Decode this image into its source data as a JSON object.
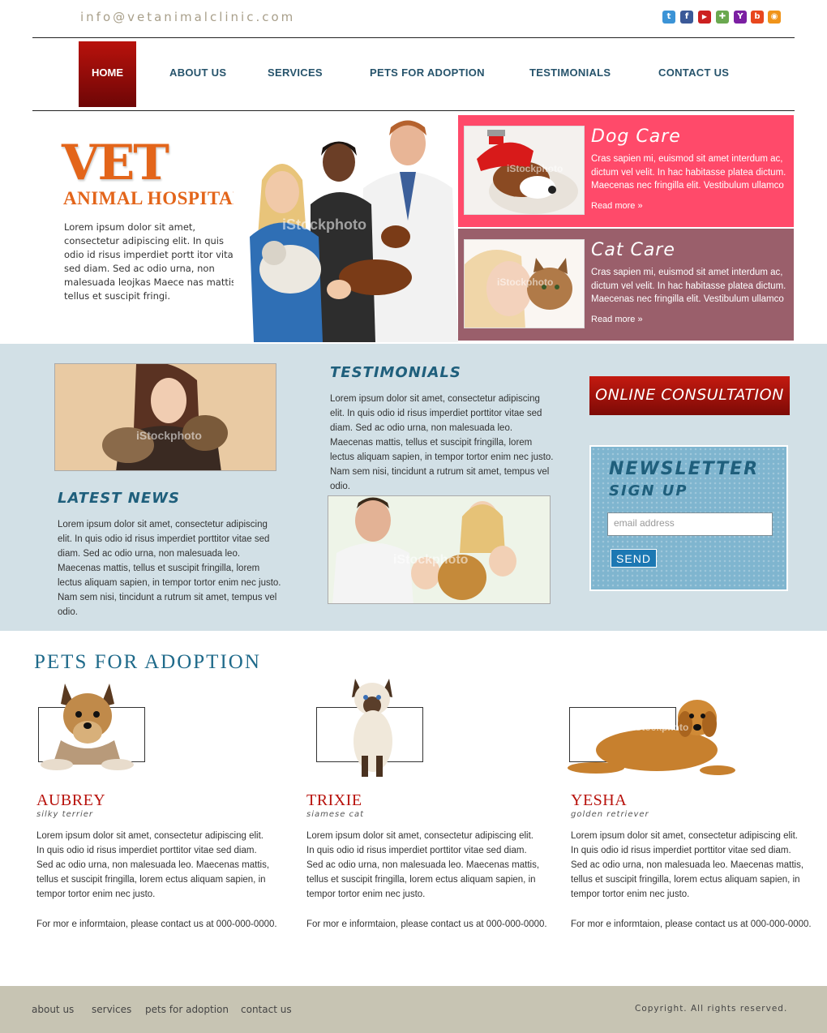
{
  "header": {
    "email": "info@vetanimalclinic.com",
    "social": [
      {
        "icon": "twitter-icon",
        "glyph": "t",
        "color": "#3b93d6"
      },
      {
        "icon": "facebook-icon",
        "glyph": "f",
        "color": "#3b5998"
      },
      {
        "icon": "youtube-icon",
        "glyph": "▶",
        "color": "#cc2020"
      },
      {
        "icon": "google-icon",
        "glyph": "✚",
        "color": "#6aa84f"
      },
      {
        "icon": "yahoo-icon",
        "glyph": "Y",
        "color": "#7b1fa2"
      },
      {
        "icon": "blogger-icon",
        "glyph": "b",
        "color": "#e8471e"
      },
      {
        "icon": "rss-icon",
        "glyph": "◉",
        "color": "#f0941a"
      }
    ]
  },
  "nav": {
    "home": "HOME",
    "about": "ABOUT US",
    "services": "SERVICES",
    "pets": "PETS FOR ADOPTION",
    "testimonials": "TESTIMONIALS",
    "contact": "CONTACT US"
  },
  "hero": {
    "title": "VET",
    "subtitle": "ANIMAL HOSPITAL",
    "text": "Lorem ipsum dolor sit amet, consectetur adipiscing elit. In quis odio id risus imperdiet portt itor vitae sed diam. Sed ac odio urna, non malesuada leojkas Maece nas mattis, tellus et suscipit fringi."
  },
  "dog_care": {
    "title": "Dog Care",
    "text": "Cras sapien mi, euismod sit amet interdum ac, dictum vel velit. In hac habitasse platea dictum.  Maecenas nec fringilla elit. Vestibulum ullamco",
    "link": "Read more »",
    "color": "#ff4a6a"
  },
  "cat_care": {
    "title": "Cat Care",
    "text": "Cras sapien mi, euismod sit amet interdum ac, dictum vel velit. In hac habitasse platea dictum.  Maecenas nec fringilla elit. Vestibulum ullamco",
    "link": "Read more »",
    "color": "#9a5f6b"
  },
  "testimonials": {
    "title": "TESTIMONIALS",
    "text": "Lorem ipsum dolor sit amet, consectetur adipiscing elit. In quis odio id risus  imperdiet porttitor vitae sed diam. Sed ac odio urna, non malesuada leo.  Maecenas mattis, tellus et suscipit fringilla, lorem lectus aliquam sapien, in tempor tortor enim nec justo. Nam sem nisi, tincidunt a rutrum sit amet, tempus vel odio."
  },
  "latest_news": {
    "title": "LATEST NEWS",
    "text": "Lorem ipsum dolor sit amet, consectetur adipiscing elit. In quis odio id risus  imperdiet porttitor vitae sed diam. Sed ac odio urna, non malesuada leo.  Maecenas mattis, tellus et suscipit fringilla, lorem lectus aliquam sapien, in tempor tortor enim nec justo. Nam sem nisi, tincidunt a rutrum sit amet, tempus vel odio."
  },
  "consultation": {
    "label": "ONLINE CONSULTATION"
  },
  "newsletter": {
    "title_line1": "NEWSLETTER",
    "title_line2": "SIGN UP",
    "placeholder": "email address",
    "button": "SEND"
  },
  "pets": {
    "title": "PETS FOR ADOPTION",
    "items": [
      {
        "name": "AUBREY",
        "breed": "silky terrier",
        "desc": "Lorem ipsum dolor sit amet, consectetur adipiscing elit. In quis odio id risus imperdiet porttitor vitae sed diam. Sed ac odio urna, non malesuada leo. Maecenas mattis, tellus et suscipit fringilla, lorem ectus aliquam sapien, in tempor tortor enim nec justo.",
        "contact": "For mor e informtaion, please contact us at 000-000-0000."
      },
      {
        "name": "TRIXIE",
        "breed": "siamese cat",
        "desc": "Lorem ipsum dolor sit amet, consectetur adipiscing elit. In quis odio id risus imperdiet porttitor vitae sed diam. Sed ac odio urna, non malesuada leo. Maecenas mattis, tellus et suscipit fringilla, lorem ectus aliquam sapien, in tempor tortor enim nec justo.",
        "contact": "For mor e informtaion, please contact us at 000-000-0000."
      },
      {
        "name": "YESHA",
        "breed": "golden retriever",
        "desc": "Lorem ipsum dolor sit amet, consectetur adipiscing elit. In quis odio id risus imperdiet porttitor vitae sed diam. Sed ac odio urna, non malesuada leo. Maecenas mattis, tellus et suscipit fringilla, lorem ectus aliquam sapien, in tempor tortor enim nec justo.",
        "contact": "For mor e informtaion, please contact us at 000-000-0000."
      }
    ]
  },
  "footer": {
    "links": [
      "about us",
      "services",
      "pets for adoption",
      "contact us"
    ],
    "copyright": "Copyright.  All rights reserved."
  },
  "watermark": "iStockphoto"
}
